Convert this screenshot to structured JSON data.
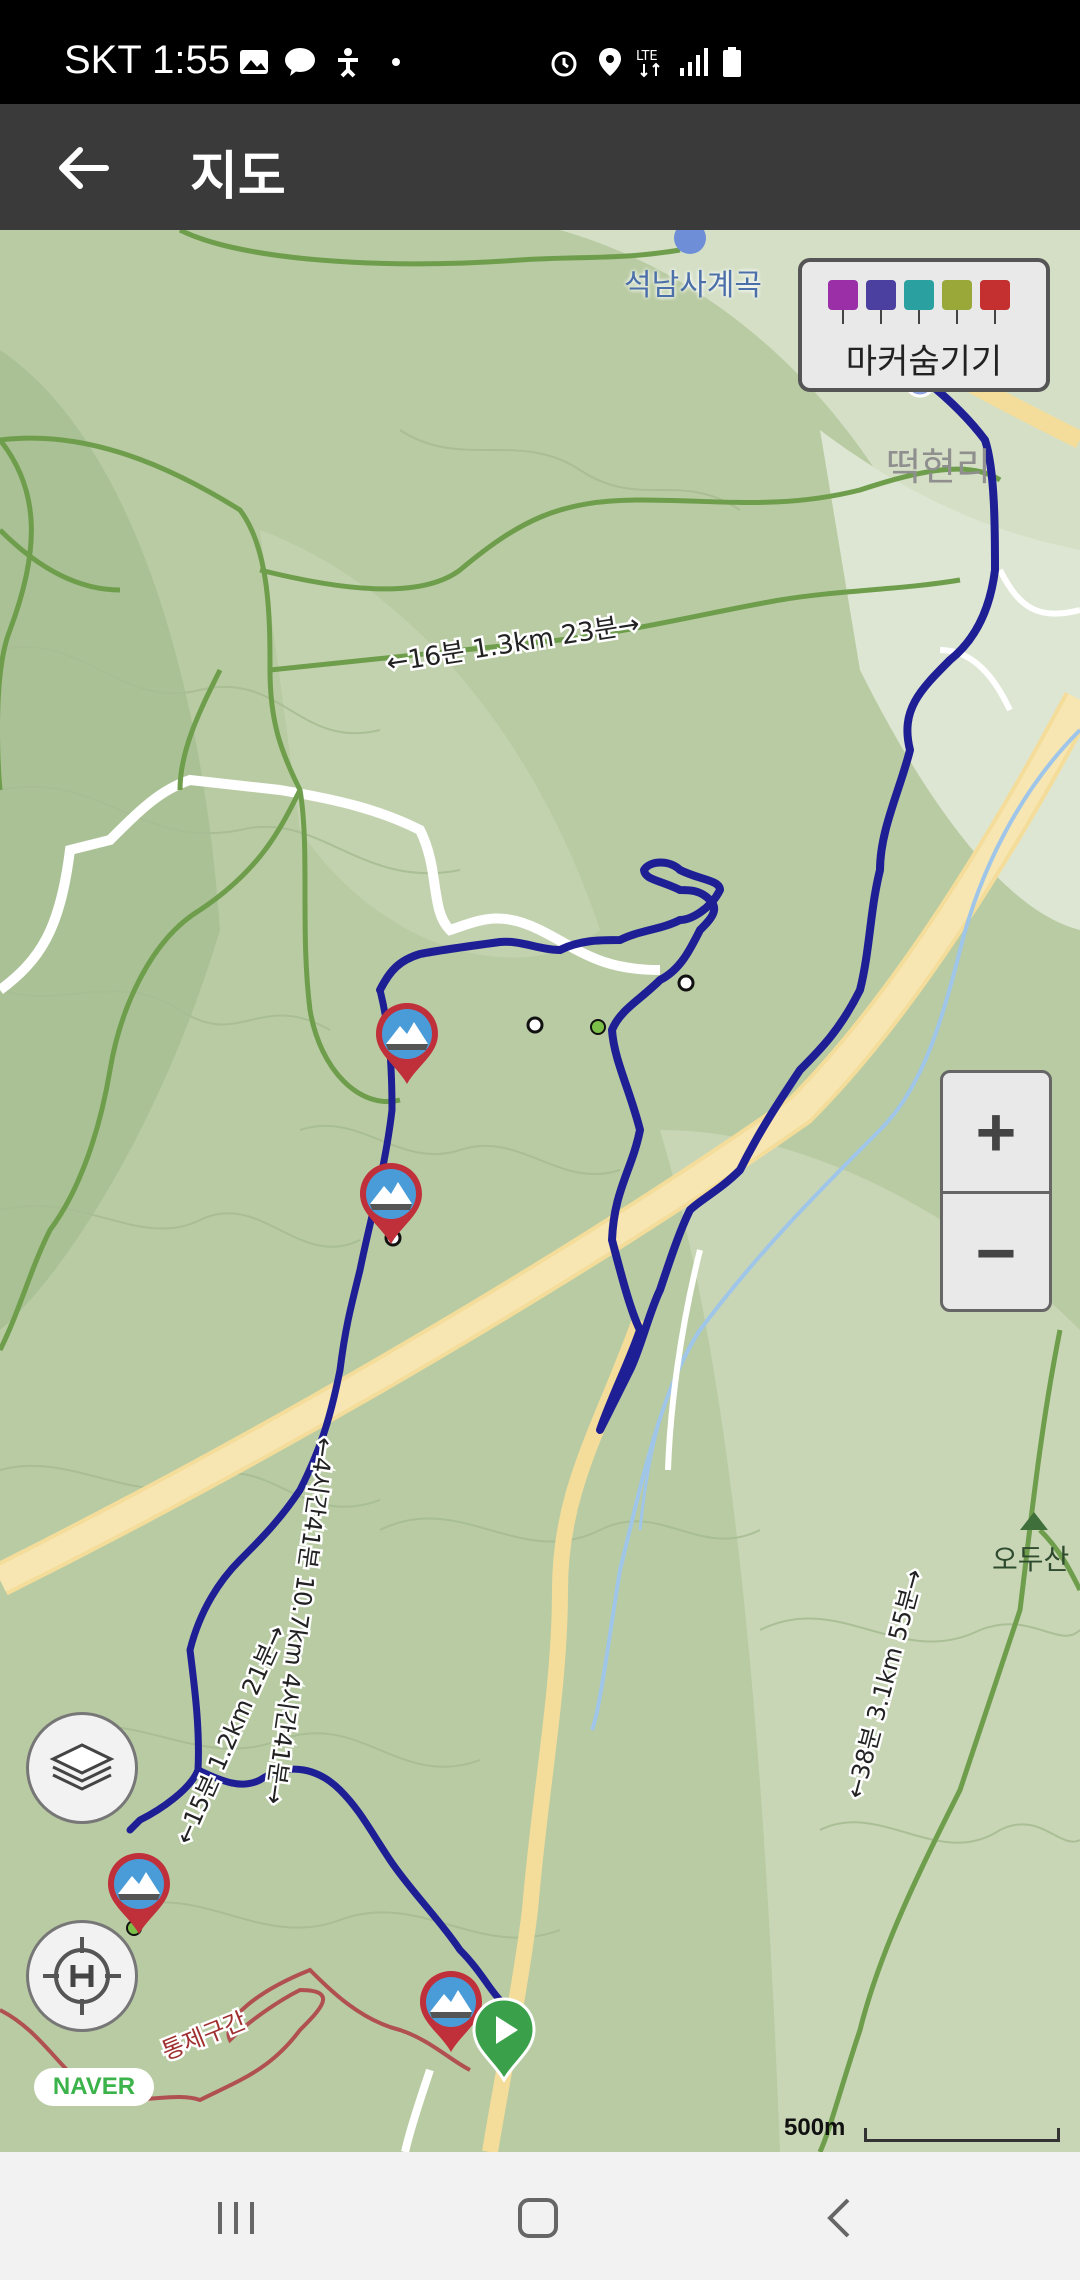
{
  "status_bar": {
    "carrier_time": "SKT 1:55",
    "network": "LTE",
    "icons": [
      "gallery-icon",
      "talk-icon",
      "accessibility-icon",
      "dot-icon",
      "alarm-icon",
      "location-icon",
      "lte-icon",
      "signal-icon",
      "battery-icon"
    ]
  },
  "header": {
    "title": "지도",
    "back_icon": "arrow-left-icon"
  },
  "map": {
    "labels": {
      "temple": "석남사계곡",
      "village": "떡현리",
      "peak": "오두산",
      "seg1": "←16분 1.3km 23분→",
      "seg2": "←4시간41분 10.7km 4시간41분→",
      "seg3": "←15분 1.2km 21분→",
      "seg4": "←38분 3.1km 55분→",
      "restricted": "통제구간"
    },
    "marker_toggle": {
      "label": "마커숨기기",
      "icons": [
        "camera-icon",
        "video-icon",
        "pin-icon",
        "memo-icon",
        "flag-icon"
      ],
      "colors": [
        "#9b2fa8",
        "#4b3fa0",
        "#2aa1a0",
        "#9aa83a",
        "#c43030"
      ]
    },
    "zoom": {
      "in": "+",
      "out": "−"
    },
    "naver": "NAVER",
    "scale": "500m"
  },
  "colors": {
    "route": "#1f1f95",
    "road_yellow": "#f3dc94",
    "trail_green": "#6e9e4c",
    "start_green": "#3aa04a",
    "pin_red": "#c0303a"
  }
}
